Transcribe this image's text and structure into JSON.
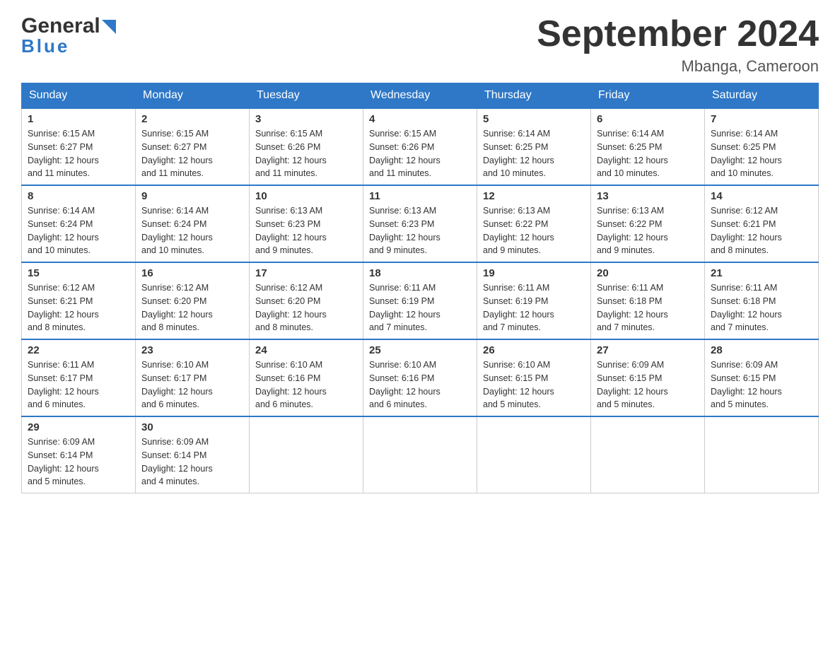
{
  "header": {
    "logo_general": "General",
    "logo_blue": "Blue",
    "month_title": "September 2024",
    "location": "Mbanga, Cameroon"
  },
  "days_of_week": [
    "Sunday",
    "Monday",
    "Tuesday",
    "Wednesday",
    "Thursday",
    "Friday",
    "Saturday"
  ],
  "weeks": [
    [
      {
        "day": "1",
        "sunrise": "6:15 AM",
        "sunset": "6:27 PM",
        "daylight": "12 hours and 11 minutes."
      },
      {
        "day": "2",
        "sunrise": "6:15 AM",
        "sunset": "6:27 PM",
        "daylight": "12 hours and 11 minutes."
      },
      {
        "day": "3",
        "sunrise": "6:15 AM",
        "sunset": "6:26 PM",
        "daylight": "12 hours and 11 minutes."
      },
      {
        "day": "4",
        "sunrise": "6:15 AM",
        "sunset": "6:26 PM",
        "daylight": "12 hours and 11 minutes."
      },
      {
        "day": "5",
        "sunrise": "6:14 AM",
        "sunset": "6:25 PM",
        "daylight": "12 hours and 10 minutes."
      },
      {
        "day": "6",
        "sunrise": "6:14 AM",
        "sunset": "6:25 PM",
        "daylight": "12 hours and 10 minutes."
      },
      {
        "day": "7",
        "sunrise": "6:14 AM",
        "sunset": "6:25 PM",
        "daylight": "12 hours and 10 minutes."
      }
    ],
    [
      {
        "day": "8",
        "sunrise": "6:14 AM",
        "sunset": "6:24 PM",
        "daylight": "12 hours and 10 minutes."
      },
      {
        "day": "9",
        "sunrise": "6:14 AM",
        "sunset": "6:24 PM",
        "daylight": "12 hours and 10 minutes."
      },
      {
        "day": "10",
        "sunrise": "6:13 AM",
        "sunset": "6:23 PM",
        "daylight": "12 hours and 9 minutes."
      },
      {
        "day": "11",
        "sunrise": "6:13 AM",
        "sunset": "6:23 PM",
        "daylight": "12 hours and 9 minutes."
      },
      {
        "day": "12",
        "sunrise": "6:13 AM",
        "sunset": "6:22 PM",
        "daylight": "12 hours and 9 minutes."
      },
      {
        "day": "13",
        "sunrise": "6:13 AM",
        "sunset": "6:22 PM",
        "daylight": "12 hours and 9 minutes."
      },
      {
        "day": "14",
        "sunrise": "6:12 AM",
        "sunset": "6:21 PM",
        "daylight": "12 hours and 8 minutes."
      }
    ],
    [
      {
        "day": "15",
        "sunrise": "6:12 AM",
        "sunset": "6:21 PM",
        "daylight": "12 hours and 8 minutes."
      },
      {
        "day": "16",
        "sunrise": "6:12 AM",
        "sunset": "6:20 PM",
        "daylight": "12 hours and 8 minutes."
      },
      {
        "day": "17",
        "sunrise": "6:12 AM",
        "sunset": "6:20 PM",
        "daylight": "12 hours and 8 minutes."
      },
      {
        "day": "18",
        "sunrise": "6:11 AM",
        "sunset": "6:19 PM",
        "daylight": "12 hours and 7 minutes."
      },
      {
        "day": "19",
        "sunrise": "6:11 AM",
        "sunset": "6:19 PM",
        "daylight": "12 hours and 7 minutes."
      },
      {
        "day": "20",
        "sunrise": "6:11 AM",
        "sunset": "6:18 PM",
        "daylight": "12 hours and 7 minutes."
      },
      {
        "day": "21",
        "sunrise": "6:11 AM",
        "sunset": "6:18 PM",
        "daylight": "12 hours and 7 minutes."
      }
    ],
    [
      {
        "day": "22",
        "sunrise": "6:11 AM",
        "sunset": "6:17 PM",
        "daylight": "12 hours and 6 minutes."
      },
      {
        "day": "23",
        "sunrise": "6:10 AM",
        "sunset": "6:17 PM",
        "daylight": "12 hours and 6 minutes."
      },
      {
        "day": "24",
        "sunrise": "6:10 AM",
        "sunset": "6:16 PM",
        "daylight": "12 hours and 6 minutes."
      },
      {
        "day": "25",
        "sunrise": "6:10 AM",
        "sunset": "6:16 PM",
        "daylight": "12 hours and 6 minutes."
      },
      {
        "day": "26",
        "sunrise": "6:10 AM",
        "sunset": "6:15 PM",
        "daylight": "12 hours and 5 minutes."
      },
      {
        "day": "27",
        "sunrise": "6:09 AM",
        "sunset": "6:15 PM",
        "daylight": "12 hours and 5 minutes."
      },
      {
        "day": "28",
        "sunrise": "6:09 AM",
        "sunset": "6:15 PM",
        "daylight": "12 hours and 5 minutes."
      }
    ],
    [
      {
        "day": "29",
        "sunrise": "6:09 AM",
        "sunset": "6:14 PM",
        "daylight": "12 hours and 5 minutes."
      },
      {
        "day": "30",
        "sunrise": "6:09 AM",
        "sunset": "6:14 PM",
        "daylight": "12 hours and 4 minutes."
      },
      null,
      null,
      null,
      null,
      null
    ]
  ],
  "labels": {
    "sunrise": "Sunrise:",
    "sunset": "Sunset:",
    "daylight": "Daylight:"
  }
}
